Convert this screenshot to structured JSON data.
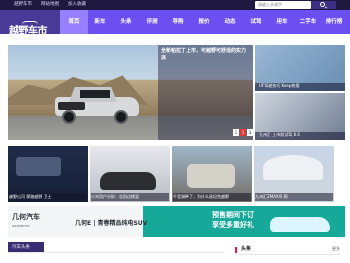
{
  "top_links": [
    "越野车市",
    "网站地图",
    "加入收藏"
  ],
  "search_placeholder": "请输入关键字",
  "logo": {
    "title": "越野车市",
    "subtitle": "YYCSYS.COM"
  },
  "nav": [
    "首页",
    "新车",
    "头条",
    "评测",
    "导购",
    "报价",
    "动态",
    "试驾",
    "用车",
    "二手车",
    "排行榜"
  ],
  "nav_active_index": 0,
  "hero": {
    "caption": "全新帕拉丁上市，可越野可舒适的实力派",
    "pages": [
      "1",
      "2",
      "3"
    ],
    "active_page_index": 1
  },
  "side_cards": [
    {
      "caption": "UF驾驶技巧 Keep热搜"
    },
    {
      "caption": "九州汇 上市前试驾 8.6"
    }
  ],
  "cards": [
    {
      "caption": "越野山河 探路越野 卫士"
    },
    {
      "caption": "小光用户分析：告别边缘混"
    },
    {
      "caption": "千里湖畔了，为什么选坦克越野"
    },
    {
      "caption": "九州汇ZMAXIS 预"
    }
  ],
  "banner": {
    "brand": "几何汽车",
    "brand_subtitle": "GEOMETRY",
    "tagline": "几何E | 青春精品纯电SUV",
    "promo_line1": "预售期间下订",
    "promo_line2": "享受多重好礼"
  },
  "bottom_tab": "汽车头条",
  "headline": {
    "title": "头条",
    "more": "更多"
  }
}
